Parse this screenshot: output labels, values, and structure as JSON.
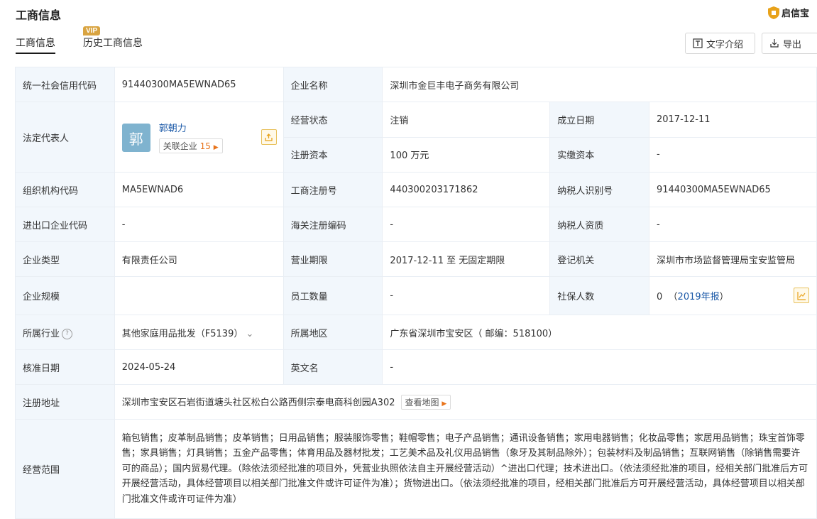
{
  "page": {
    "title": "工商信息",
    "brand": "启信宝"
  },
  "tabs": {
    "active": "工商信息",
    "history": "历史工商信息",
    "vip_badge": "VIP"
  },
  "buttons": {
    "intro": "文字介绍",
    "export": "导出"
  },
  "labels": {
    "credit_code": "统一社会信用代码",
    "company_name": "企业名称",
    "legal_rep": "法定代表人",
    "status": "经营状态",
    "found_date": "成立日期",
    "reg_capital": "注册资本",
    "paid_capital": "实缴资本",
    "org_code": "组织机构代码",
    "reg_no": "工商注册号",
    "tax_id": "纳税人识别号",
    "import_code": "进出口企业代码",
    "customs_code": "海关注册编码",
    "tax_qual": "纳税人资质",
    "type": "企业类型",
    "term": "营业期限",
    "authority": "登记机关",
    "scale": "企业规模",
    "employees": "员工数量",
    "insured": "社保人数",
    "industry": "所属行业",
    "region": "所属地区",
    "approve_date": "核准日期",
    "english_name": "英文名",
    "address": "注册地址",
    "scope": "经营范围"
  },
  "values": {
    "credit_code": "91440300MA5EWNAD65",
    "company_name": "深圳市金巨丰电子商务有限公司",
    "legal_rep": {
      "avatar_char": "郭",
      "name": "郭朝力",
      "related_label": "关联企业",
      "related_count": "15"
    },
    "status": "注销",
    "found_date": "2017-12-11",
    "reg_capital": "100 万元",
    "paid_capital": "-",
    "org_code": "MA5EWNAD6",
    "reg_no": "440300203171862",
    "tax_id": "91440300MA5EWNAD65",
    "import_code": "-",
    "customs_code": "-",
    "tax_qual": "-",
    "type": "有限责任公司",
    "term": "2017-12-11 至 无固定期限",
    "authority": "深圳市市场监督管理局宝安监管局",
    "scale": "",
    "employees": "-",
    "insured_count": "0",
    "insured_report": "2019年报",
    "industry": "其他家庭用品批发（F5139）",
    "region": "广东省深圳市宝安区（ 邮编：518100）",
    "approve_date": "2024-05-24",
    "english_name": "-",
    "address": "深圳市宝安区石岩街道塘头社区松白公路西侧宗泰电商科创园A302",
    "map_link": "查看地图",
    "scope": "箱包销售；皮革制品销售；皮革销售；日用品销售；服装服饰零售；鞋帽零售；电子产品销售；通讯设备销售；家用电器销售；化妆品零售；家居用品销售；珠宝首饰零售；家具销售；灯具销售；五金产品零售；体育用品及器材批发；工艺美术品及礼仪用品销售（象牙及其制品除外）；包装材料及制品销售；互联网销售（除销售需要许可的商品）；国内贸易代理。（除依法须经批准的项目外，凭营业执照依法自主开展经营活动）^进出口代理；技术进出口。（依法须经批准的项目，经相关部门批准后方可开展经营活动，具体经营项目以相关部门批准文件或许可证件为准）；货物进出口。（依法须经批准的项目，经相关部门批准后方可开展经营活动，具体经营项目以相关部门批准文件或许可证件为准）"
  },
  "icons": {
    "brand": "shield-icon",
    "intro": "text-icon",
    "export": "download-icon",
    "share": "share-icon",
    "trend": "chart-icon",
    "help": "question-icon",
    "expand": "chevron-down-icon"
  },
  "colors": {
    "link": "#1c5aa8",
    "label_bg": "#f2f7fc",
    "accent": "#e8731a",
    "vip": "#d9a441"
  }
}
